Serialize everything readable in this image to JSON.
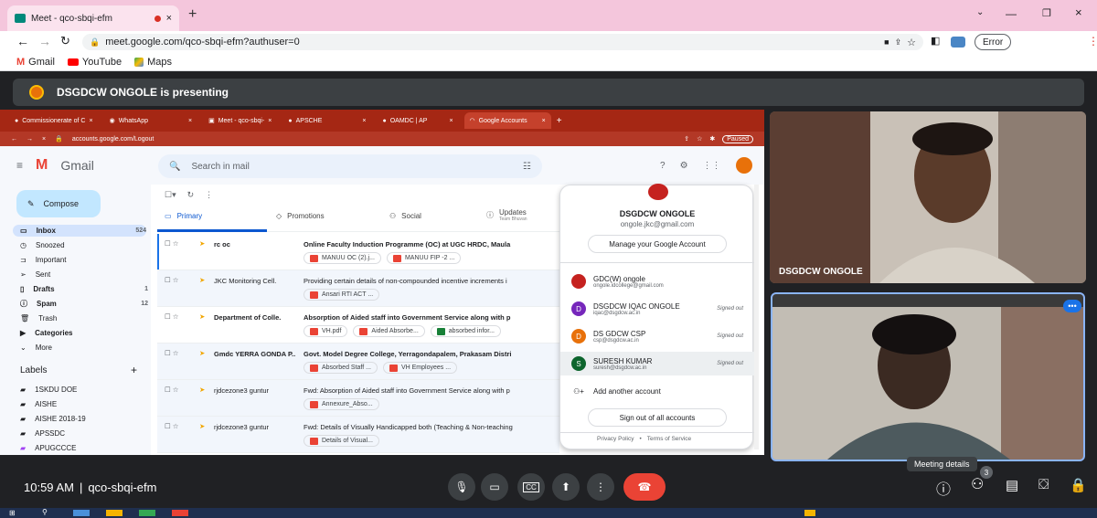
{
  "browser": {
    "tab_title": "Meet - qco-sbqi-efm",
    "new_tab_icon": "+",
    "url": "meet.google.com/qco-sbqi-efm?authuser=0",
    "error_label": "Error",
    "bookmarks": [
      {
        "label": "Gmail",
        "icon": "gmail-icon"
      },
      {
        "label": "YouTube",
        "icon": "youtube-icon"
      },
      {
        "label": "Maps",
        "icon": "maps-icon"
      }
    ]
  },
  "meet": {
    "presenting_text": "DSGDCW ONGOLE is presenting",
    "time": "10:59 AM",
    "separator": "|",
    "meeting_code": "qco-sbqi-efm",
    "meeting_details_tooltip": "Meeting details",
    "participants_count": "3",
    "tiles": [
      {
        "name": "DSGDCW ONGOLE"
      },
      {
        "name": ""
      }
    ]
  },
  "shared_screen": {
    "tabs": [
      {
        "label": "Commissionerate of C"
      },
      {
        "label": "WhatsApp"
      },
      {
        "label": "Meet - qco-sbqi-"
      },
      {
        "label": "APSCHE"
      },
      {
        "label": "OAMDC | AP"
      },
      {
        "label": "Google Accounts"
      }
    ],
    "url": "accounts.google.com/Logout",
    "paused_label": "Paused",
    "gmail": {
      "app_name": "Gmail",
      "search_placeholder": "Search in mail",
      "compose_label": "Compose",
      "sidebar": [
        {
          "label": "Inbox",
          "count": "524"
        },
        {
          "label": "Snoozed",
          "count": ""
        },
        {
          "label": "Important",
          "count": ""
        },
        {
          "label": "Sent",
          "count": ""
        },
        {
          "label": "Drafts",
          "count": "1"
        },
        {
          "label": "Spam",
          "count": "12"
        },
        {
          "label": "Trash",
          "count": ""
        },
        {
          "label": "Categories",
          "count": ""
        },
        {
          "label": "More",
          "count": ""
        }
      ],
      "labels_heading": "Labels",
      "labels": [
        "1SKDU DOE",
        "AISHE",
        "AISHE 2018-19",
        "APSSDC",
        "APUGCCCE"
      ],
      "tabs": [
        {
          "label": "Primary"
        },
        {
          "label": "Promotions"
        },
        {
          "label": "Social"
        },
        {
          "label": "Updates",
          "sub": "Team Bhuvan"
        }
      ],
      "emails": [
        {
          "sender": "rc oc",
          "subject": "Online Faculty Induction Programme (OC) at UGC HRDC, Maula",
          "attachments": [
            {
              "name": "MANUU OC (2).j...",
              "type": "pdf"
            },
            {
              "name": "MANUU FIP -2 ...",
              "type": "pdf"
            }
          ]
        },
        {
          "sender": "JKC Monitoring Cell.",
          "subject": "Providing certain details of non-compounded incentive increments i",
          "attachments": [
            {
              "name": "Ansari RTI ACT ...",
              "type": "pdf"
            }
          ]
        },
        {
          "sender": "Department of Colle.",
          "subject": "Absorption of Aided staff into Government Service along with p",
          "attachments": [
            {
              "name": "VH.pdf",
              "type": "pdf"
            },
            {
              "name": "Aided Absorbe...",
              "type": "pdf"
            },
            {
              "name": "absorbed infor...",
              "type": "xls"
            }
          ]
        },
        {
          "sender": "Gmdc YERRA GONDA P..",
          "subject": "Govt. Model Degree College, Yerragondapalem, Prakasam Distri",
          "attachments": [
            {
              "name": "Absorbed Staff ...",
              "type": "pdf"
            },
            {
              "name": "VH Employees ...",
              "type": "pdf"
            }
          ]
        },
        {
          "sender": "rjdcezone3 guntur",
          "subject": "Fwd: Absorption of Aided staff into Government Service along with p",
          "attachments": [
            {
              "name": "Annexure_Abso...",
              "type": "pdf"
            }
          ]
        },
        {
          "sender": "rjdcezone3 guntur",
          "subject": "Fwd: Details of Visually Handicapped both (Teaching & Non-teaching",
          "attachments": [
            {
              "name": "Details of Visual...",
              "type": "pdf"
            }
          ]
        }
      ]
    },
    "account_popup": {
      "name": "DSGDCW ONGOLE",
      "email": "ongole.jkc@gmail.com",
      "manage_label": "Manage your Google Account",
      "accounts": [
        {
          "name": "GDC(W) ongole",
          "email": "ongole.idcollege@gmail.com",
          "initial": "",
          "color": "#c5221f",
          "status": ""
        },
        {
          "name": "DSGDCW IQAC ONGOLE",
          "email": "iqac@dsgdcw.ac.in",
          "initial": "D",
          "color": "#7627bb",
          "status": "Signed out"
        },
        {
          "name": "DS GDCW CSP",
          "email": "csp@dsgdcw.ac.in",
          "initial": "D",
          "color": "#e8710a",
          "status": "Signed out"
        },
        {
          "name": "SURESH KUMAR",
          "email": "suresh@dsgdcw.ac.in",
          "initial": "S",
          "color": "#0d652d",
          "status": "Signed out"
        }
      ],
      "add_account_label": "Add another account",
      "signout_label": "Sign out of all accounts",
      "privacy_label": "Privacy Policy",
      "dot": "•",
      "terms_label": "Terms of Service"
    }
  },
  "colors": {
    "end_call": "#ea4335",
    "meet_bg": "#202124",
    "accent": "#8ab4f8"
  }
}
